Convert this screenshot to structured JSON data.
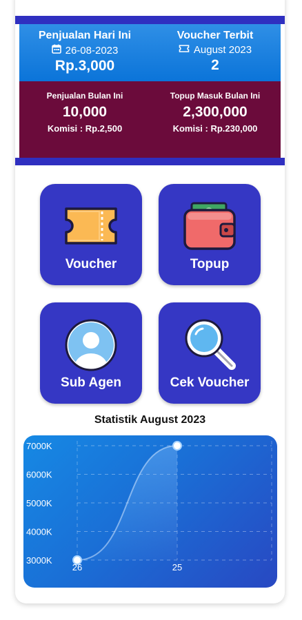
{
  "sales_today": {
    "title": "Penjualan Hari Ini",
    "date": "26-08-2023",
    "amount": "Rp.3,000",
    "icon": "calendar-icon"
  },
  "voucher_issued": {
    "title": "Voucher Terbit",
    "period": "August 2023",
    "count": "2",
    "icon": "ticket-icon"
  },
  "monthly_sales": {
    "title": "Penjualan Bulan Ini",
    "value": "10,000",
    "commission": "Komisi : Rp.2,500"
  },
  "monthly_topup": {
    "title": "Topup Masuk Bulan Ini",
    "value": "2,300,000",
    "commission": "Komisi : Rp.230,000"
  },
  "menu": [
    {
      "label": "Voucher",
      "icon": "voucher-ticket-icon"
    },
    {
      "label": "Topup",
      "icon": "wallet-icon"
    },
    {
      "label": "Sub Agen",
      "icon": "user-avatar-icon"
    },
    {
      "label": "Cek Voucher",
      "icon": "magnifier-icon"
    }
  ],
  "statistics_title": "Statistik August 2023",
  "colors": {
    "band": "#2f2fc0",
    "blue_panel": "#0b74d9",
    "maroon_panel": "#6b0b3b",
    "tile": "#3537c4",
    "chart_bg": "#1a6fd6"
  },
  "chart_data": {
    "type": "area",
    "x": [
      "26",
      "25"
    ],
    "series": [
      {
        "values": [
          3000,
          7000
        ]
      }
    ],
    "y_ticks": [
      "3000K",
      "4000K",
      "5000K",
      "6000K",
      "7000K"
    ],
    "ylim": [
      3000,
      7000
    ],
    "unit": "K",
    "grid": true
  }
}
